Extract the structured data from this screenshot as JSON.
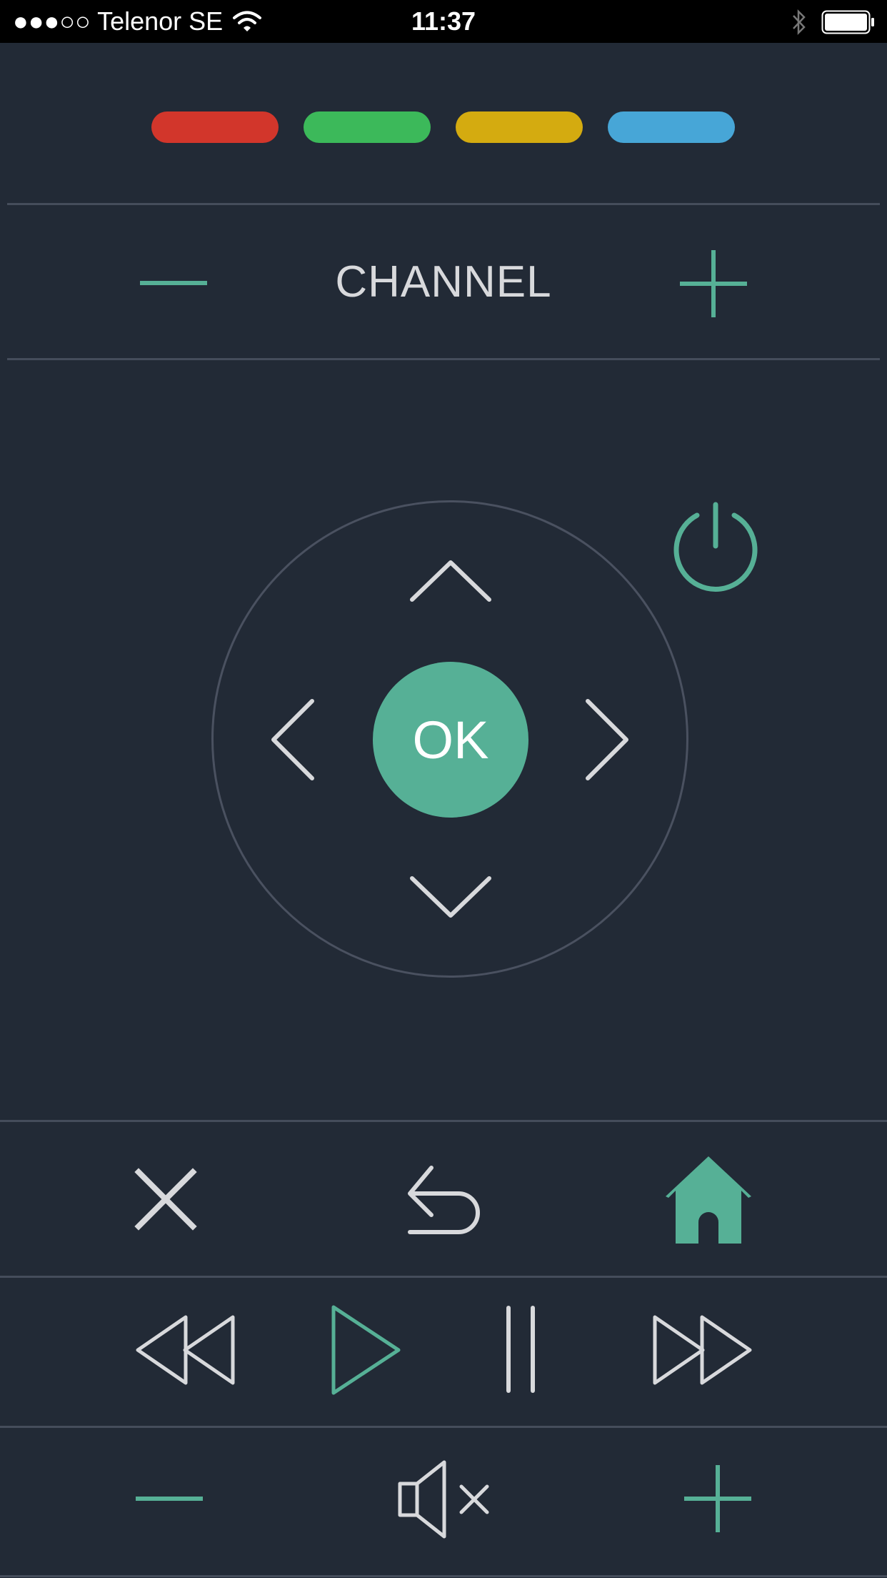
{
  "status_bar": {
    "signal": "●●●○○",
    "carrier": "Telenor SE",
    "time": "11:37",
    "icons": [
      "wifi-icon",
      "bluetooth-icon",
      "battery-icon"
    ]
  },
  "color_keys": [
    {
      "name": "red-key",
      "color": "#d2362b"
    },
    {
      "name": "green-key",
      "color": "#3cb95a"
    },
    {
      "name": "yellow-key",
      "color": "#d4ab10"
    },
    {
      "name": "blue-key",
      "color": "#47a6d7"
    }
  ],
  "channel": {
    "label": "CHANNEL",
    "minus_icon": "minus-icon",
    "plus_icon": "plus-icon"
  },
  "dpad": {
    "ok_label": "OK",
    "icons": [
      "chevron-up-icon",
      "chevron-left-icon",
      "chevron-right-icon",
      "chevron-down-icon"
    ]
  },
  "power_icon": "power-icon",
  "nav_row": {
    "icons": [
      "close-icon",
      "back-icon",
      "home-icon"
    ]
  },
  "playback_row": {
    "icons": [
      "rewind-icon",
      "play-icon",
      "pause-icon",
      "fast-forward-icon"
    ]
  },
  "volume_row": {
    "icons": [
      "volume-down-icon",
      "mute-icon",
      "volume-up-icon"
    ]
  },
  "colors": {
    "background": "#222a36",
    "accent": "#56b096",
    "icon_light": "#d8d9dc",
    "divider": "#454d5b"
  }
}
